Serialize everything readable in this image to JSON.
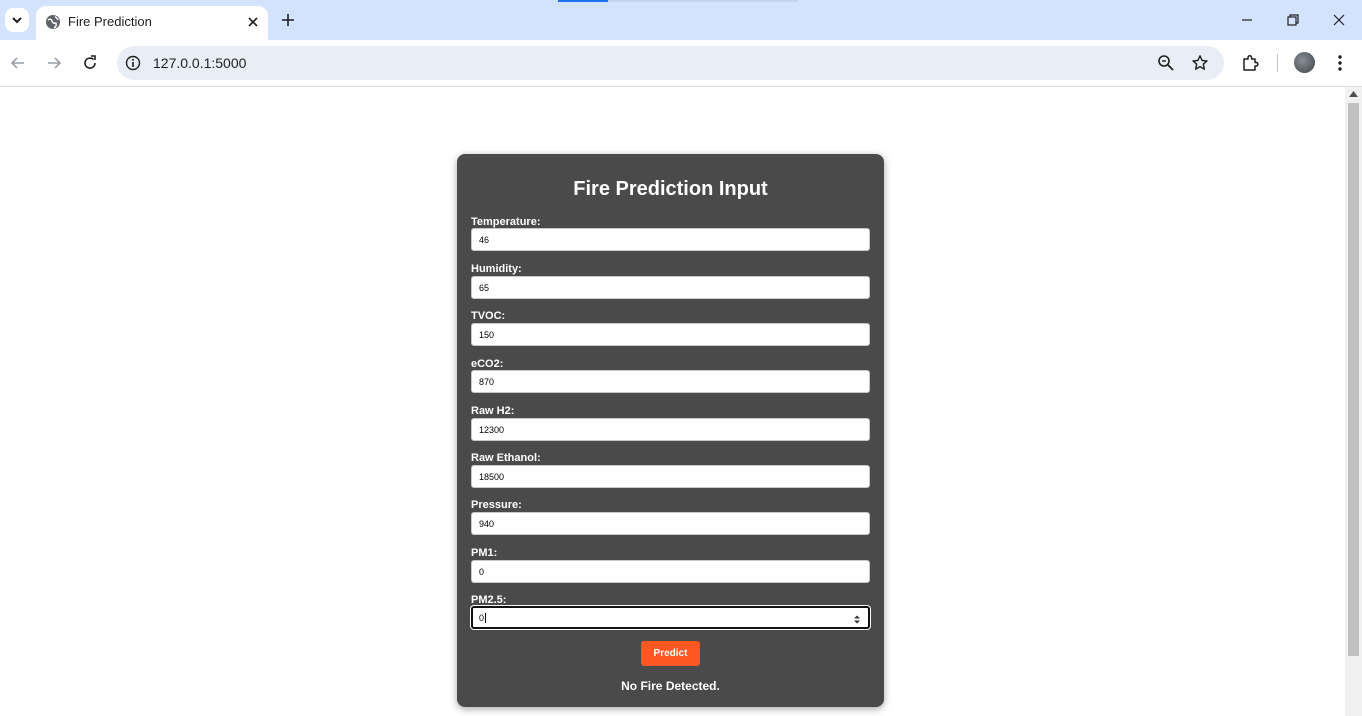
{
  "browser": {
    "tab_title": "Fire Prediction",
    "url": "127.0.0.1:5000"
  },
  "form": {
    "title": "Fire Prediction Input",
    "fields": [
      {
        "label": "Temperature:",
        "value": "46"
      },
      {
        "label": "Humidity:",
        "value": "65"
      },
      {
        "label": "TVOC:",
        "value": "150"
      },
      {
        "label": "eCO2:",
        "value": "870"
      },
      {
        "label": "Raw H2:",
        "value": "12300"
      },
      {
        "label": "Raw Ethanol:",
        "value": "18500"
      },
      {
        "label": "Pressure:",
        "value": "940"
      },
      {
        "label": "PM1:",
        "value": "0"
      },
      {
        "label": "PM2.5:",
        "value": "0"
      }
    ],
    "submit_label": "Predict",
    "result_text": "No Fire Detected."
  },
  "colors": {
    "card_background": "#4a4a4a",
    "button_accent": "#ff5722",
    "browser_frame": "#d3e3fd"
  }
}
